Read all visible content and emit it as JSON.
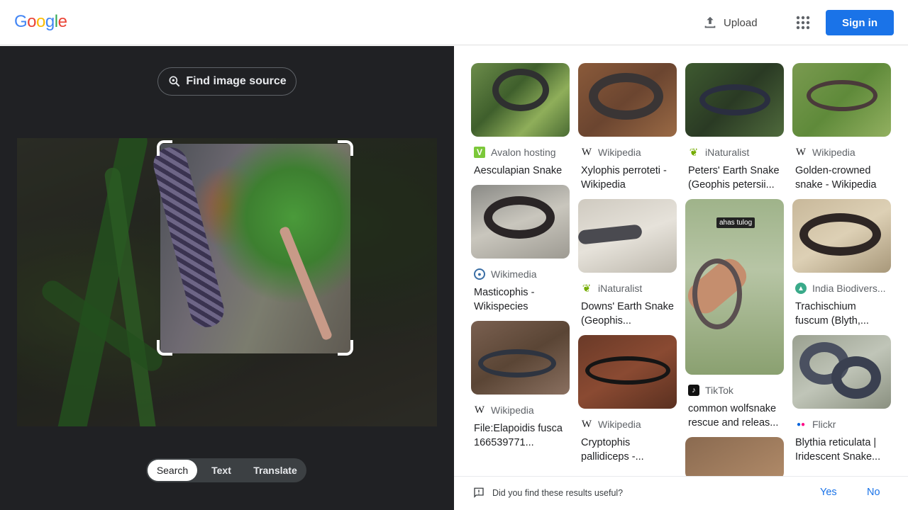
{
  "header": {
    "logo": "Google",
    "upload_label": "Upload",
    "signin_label": "Sign in"
  },
  "left": {
    "find_source_label": "Find image source",
    "tabs": [
      {
        "label": "Search",
        "active": true
      },
      {
        "label": "Text",
        "active": false
      },
      {
        "label": "Translate",
        "active": false
      }
    ]
  },
  "results": [
    {
      "source": "Avalon hosting",
      "title": "Aesculapian Snake",
      "icon": "avalon-icon"
    },
    {
      "source": "Xylophis perroteti - Wikipedia",
      "source_name": "Wikipedia",
      "title": "Xylophis perroteti - Wikipedia",
      "icon": "wikipedia-icon"
    },
    {
      "source": "iNaturalist",
      "title": "Peters' Earth Snake (Geophis petersii...",
      "icon": "inaturalist-icon"
    },
    {
      "source": "Wikipedia",
      "title": "Golden-crowned snake - Wikipedia",
      "icon": "wikipedia-icon"
    },
    {
      "source": "Wikimedia",
      "title": "Masticophis - Wikispecies",
      "icon": "wikimedia-icon"
    },
    {
      "source": "iNaturalist",
      "title": "Downs' Earth Snake (Geophis...",
      "icon": "inaturalist-icon"
    },
    {
      "source": "TikTok",
      "title": "common wolfsnake rescue and releas...",
      "icon": "tiktok-icon",
      "overlay_text": "ahas tulog"
    },
    {
      "source": "India Biodivers...",
      "title": "Trachischium fuscum (Blyth,...",
      "icon": "india-biodiversity-icon"
    },
    {
      "source": "Wikipedia",
      "title": "File:Elapoidis fusca 166539771...",
      "icon": "wikipedia-icon"
    },
    {
      "source": "Wikipedia",
      "title": "Cryptophis pallidiceps -...",
      "icon": "wikipedia-icon"
    },
    {
      "source": "Flickr",
      "title": "Blythia reticulata | Iridescent Snake...",
      "icon": "flickr-icon"
    }
  ],
  "feedback": {
    "question": "Did you find these results useful?",
    "yes": "Yes",
    "no": "No"
  },
  "colors": {
    "accent": "#1a73e8",
    "left_bg": "#202124"
  }
}
